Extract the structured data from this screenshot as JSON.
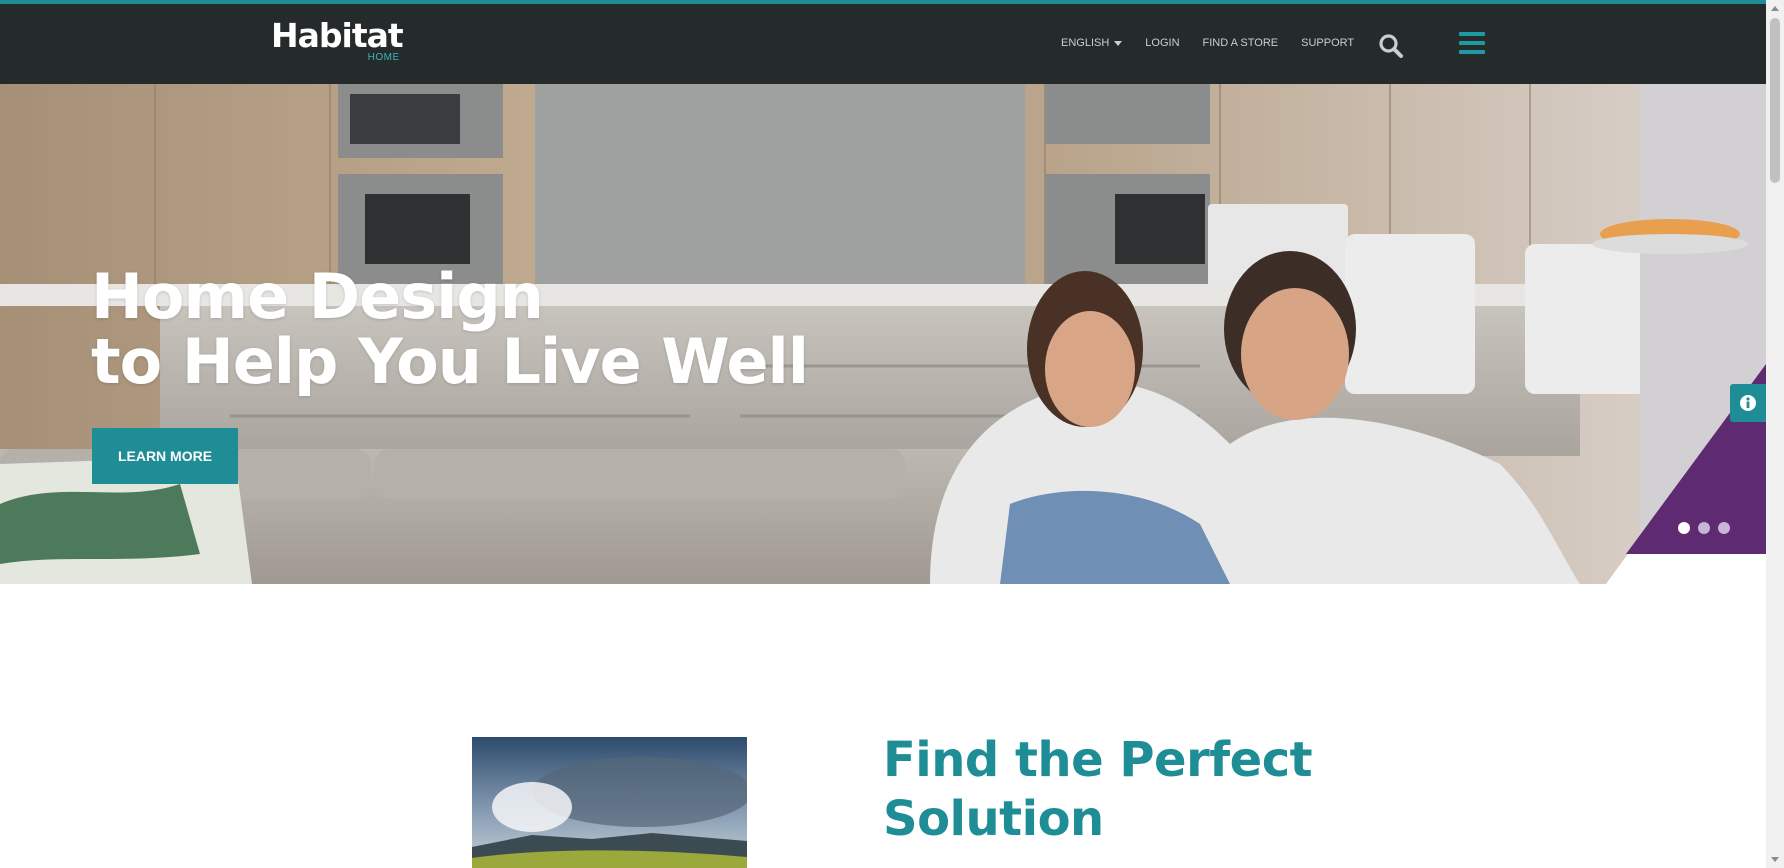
{
  "header": {
    "logo": {
      "name": "Habitat",
      "subtitle": "HOME"
    },
    "nav": {
      "language_label": "ENGLISH",
      "login_label": "LOGIN",
      "find_store_label": "FIND A STORE",
      "support_label": "SUPPORT"
    },
    "icons": {
      "search": "search-icon",
      "menu": "hamburger-menu-icon"
    }
  },
  "hero": {
    "title_line1": "Home Design",
    "title_line2": "to Help You Live Well",
    "cta_label": "LEARN MORE",
    "slides": {
      "count": 3,
      "active_index": 0
    }
  },
  "side_tab": {
    "icon": "info-icon"
  },
  "feature": {
    "title_line1": "Find the Perfect",
    "title_line2": "Solution"
  },
  "colors": {
    "header_bg": "#252a2b",
    "accent_teal": "#1e8d95",
    "accent_purple": "#5e2a72",
    "white": "#ffffff"
  }
}
